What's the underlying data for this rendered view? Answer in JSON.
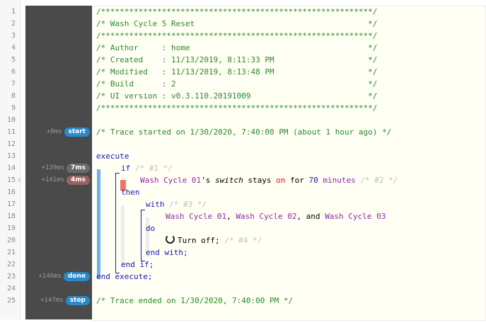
{
  "lines": [
    {
      "n": "1",
      "trace": "",
      "badge": "",
      "code": "/**********************************************************/"
    },
    {
      "n": "2",
      "code": "/* Wash Cycle 5 Reset                                     */"
    },
    {
      "n": "3",
      "code": "/**********************************************************/"
    },
    {
      "n": "4",
      "code": "/* Author     : home                                      */"
    },
    {
      "n": "5",
      "code": "/* Created    : 11/13/2019, 8:11:33 PM                    */"
    },
    {
      "n": "6",
      "code": "/* Modified   : 11/13/2019, 8:13:48 PM                    */"
    },
    {
      "n": "7",
      "code": "/* Build      : 2                                         */"
    },
    {
      "n": "8",
      "code": "/* UI version : v0.3.110.20191009                         */"
    },
    {
      "n": "9",
      "code": "/**********************************************************/"
    },
    {
      "n": "10"
    },
    {
      "n": "11",
      "trace": "+0ms",
      "badge": "start",
      "code": "/* Trace started on 1/30/2020, 7:40:00 PM (about 1 hour ago) */"
    },
    {
      "n": "12"
    },
    {
      "n": "13",
      "kw": "execute"
    },
    {
      "n": "14",
      "trace": "+139ms",
      "badge": "7ms",
      "kw": "if",
      "comment": "/* #1 */"
    },
    {
      "n": "15",
      "trace": "+141ms",
      "badge": "4ms",
      "device": "Wash Cycle 01",
      "poss": "'s ",
      "attr": "switch",
      "stays": " stays ",
      "on": "on",
      "for": " for ",
      "num": "70",
      "unit": " minutes",
      "comment": "/* #2 */"
    },
    {
      "n": "16",
      "kw": "then"
    },
    {
      "n": "17",
      "kw": "with",
      "comment": "/* #3 */"
    },
    {
      "n": "18",
      "devices": [
        "Wash Cycle 01",
        "Wash Cycle 02",
        "Wash Cycle 03"
      ],
      "sep": ", ",
      "and": ", and "
    },
    {
      "n": "19",
      "kw": "do"
    },
    {
      "n": "20",
      "text": "Turn off;",
      "comment": "/* #4 */"
    },
    {
      "n": "21",
      "kw": "end with;"
    },
    {
      "n": "22",
      "kw": "end if;"
    },
    {
      "n": "23",
      "trace": "+146ms",
      "badge": "done",
      "kw": "end execute;"
    },
    {
      "n": "24"
    },
    {
      "n": "25",
      "trace": "+147ms",
      "badge": "stop",
      "code": "/* Trace ended on 1/30/2020, 7:40:00 PM */"
    }
  ]
}
